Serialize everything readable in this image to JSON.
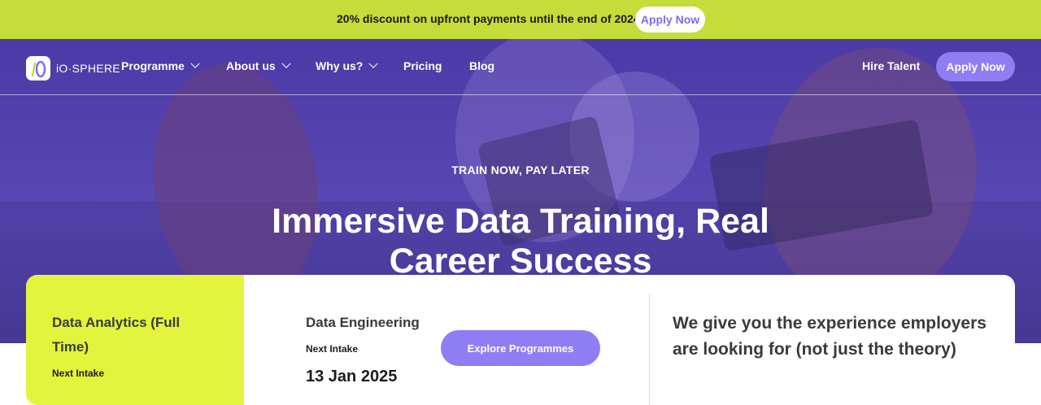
{
  "promo": {
    "text": "20% discount on upfront payments until the end of 2024 ∎",
    "button": "Apply Now"
  },
  "nav": {
    "logo": {
      "text": "iO·SPHERE",
      "icon": "io-sphere-logo-icon"
    },
    "items": [
      {
        "label": "Programme",
        "dropdown": true
      },
      {
        "label": "About us",
        "dropdown": true
      },
      {
        "label": "Why us?",
        "dropdown": true
      },
      {
        "label": "Pricing",
        "dropdown": false
      },
      {
        "label": "Blog",
        "dropdown": false
      }
    ],
    "hire_talent": "Hire Talent",
    "apply_button": "Apply Now"
  },
  "hero": {
    "eyebrow": "TRAIN NOW, PAY LATER",
    "headline": "Immersive Data Training, Real Career Success"
  },
  "programmes": [
    {
      "title": "Data Analytics (Full Time)",
      "next_label": "Next Intake",
      "selected": true
    },
    {
      "title": "Data Engineering",
      "next_label": "Next Intake",
      "date": "13 Jan 2025"
    }
  ],
  "explore_button": "Explore Programmes",
  "tagline": "We give you the experience employers are looking for (not just the theory)",
  "colors": {
    "promo_bg": "#c5dc3a",
    "accent_purple": "#8f7df4",
    "hero_overlay": "#4b3aa7",
    "active_panel": "#e2f43c"
  }
}
